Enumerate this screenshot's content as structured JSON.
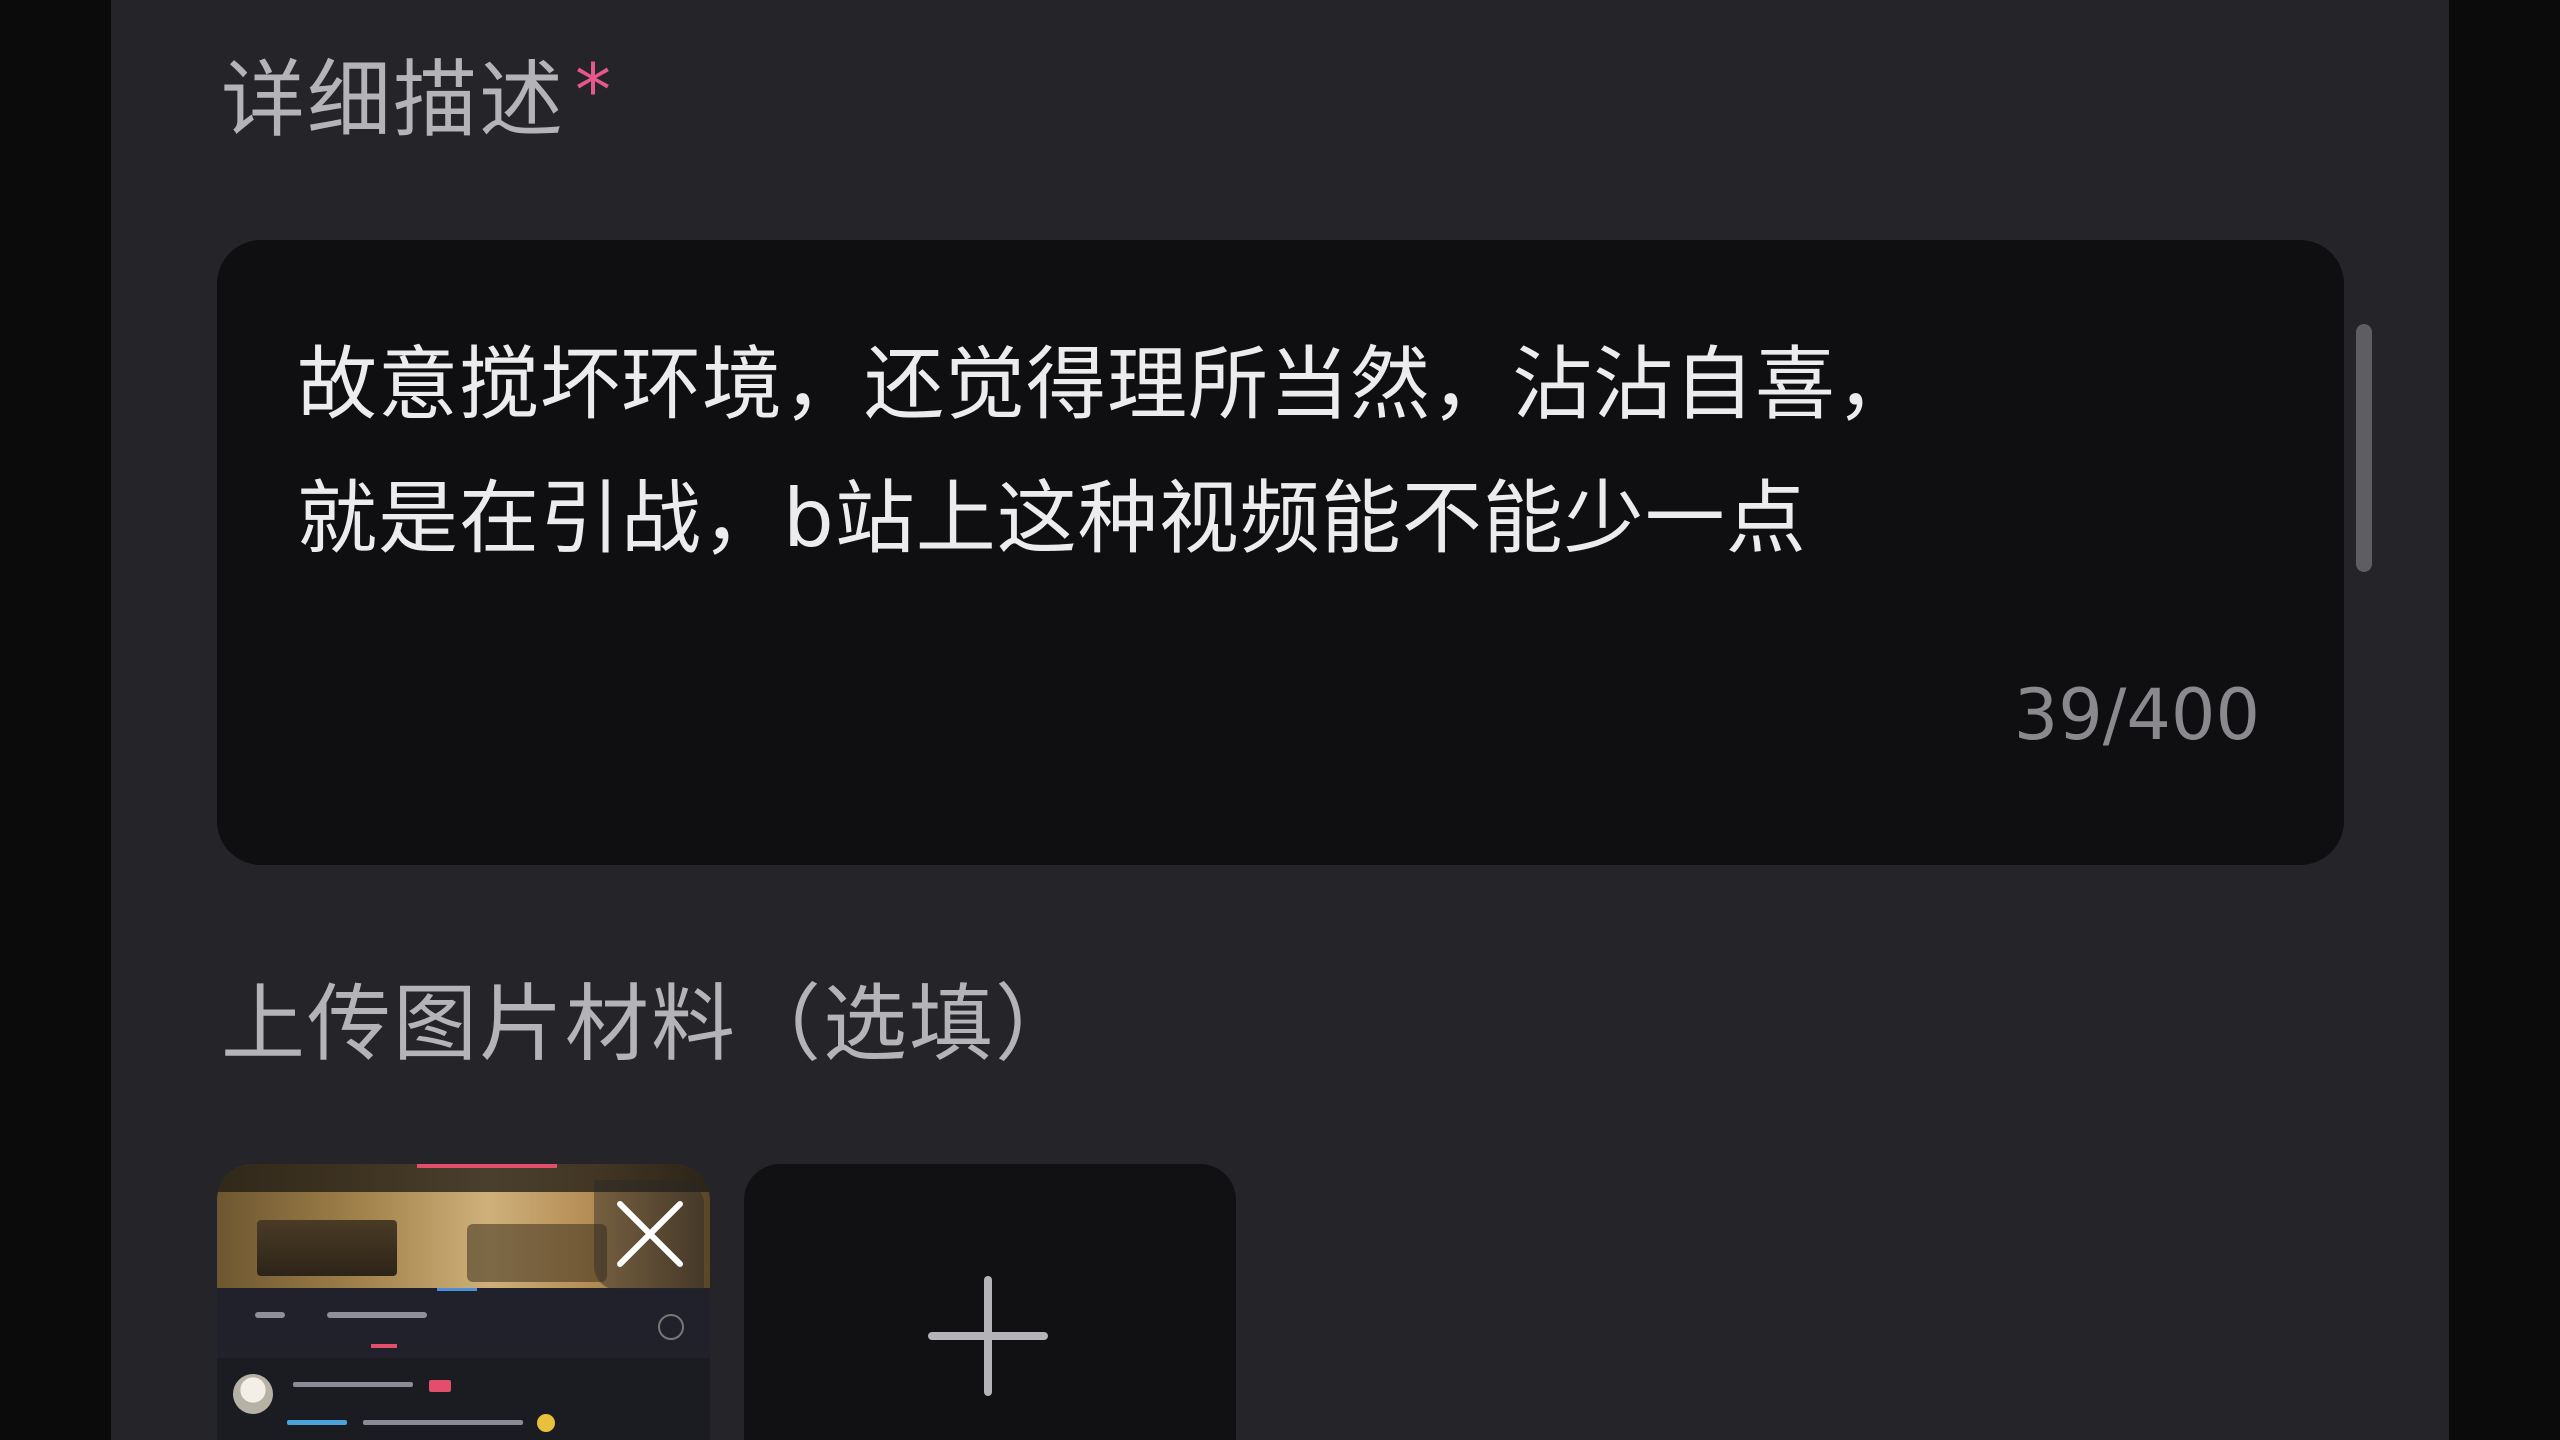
{
  "description": {
    "title": "详细描述",
    "required_mark": "*",
    "text": "故意搅坏环境，还觉得理所当然，沾沾自喜，\n就是在引战，b站上这种视频能不能少一点",
    "char_count": "39/400"
  },
  "upload": {
    "title": "上传图片材料（选填）",
    "uploaded_images": [
      {
        "remove_icon": "close-icon"
      }
    ],
    "add_icon": "plus-icon"
  },
  "colors": {
    "required_star": "#e4588a",
    "panel_bg": "#252529",
    "field_bg": "#0f0f11",
    "accent_pink": "#e24e6b"
  }
}
